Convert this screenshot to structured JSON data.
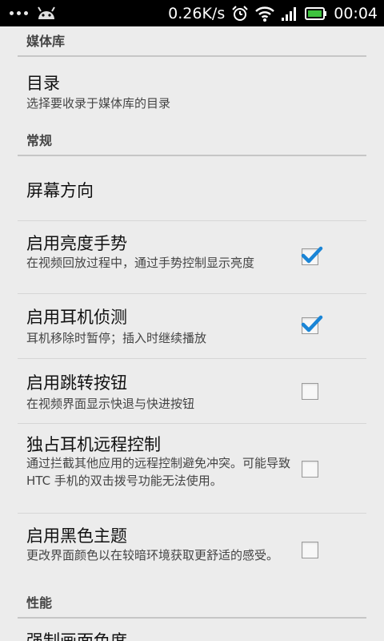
{
  "status_bar": {
    "net_speed": "0.26K/s",
    "time": "00:04",
    "icons": [
      "android-icon",
      "alarm-icon",
      "wifi-icon",
      "signal-icon",
      "battery-icon"
    ]
  },
  "colors": {
    "accent": "#1a85d6",
    "battery": "#3ec23e"
  },
  "sections": {
    "media": {
      "label": "媒体库"
    },
    "general": {
      "label": "常规"
    },
    "performance": {
      "label": "性能"
    }
  },
  "prefs": {
    "directory": {
      "title": "目录",
      "summary": "选择要收录于媒体库的目录"
    },
    "orientation": {
      "title": "屏幕方向"
    },
    "brightness": {
      "title": "启用亮度手势",
      "summary": "在视频回放过程中，通过手势控制显示亮度",
      "checked": true
    },
    "headset": {
      "title": "启用耳机侦测",
      "summary": "耳机移除时暂停；插入时继续播放",
      "checked": true
    },
    "jump": {
      "title": "启用跳转按钮",
      "summary": "在视频界面显示快退与快进按钮",
      "checked": false
    },
    "remote": {
      "title": "独占耳机远程控制",
      "summary": "通过拦截其他应用的远程控制避免冲突。可能导致 HTC 手机的双击拨号功能无法使用。",
      "checked": false
    },
    "dark_theme": {
      "title": "启用黑色主题",
      "summary": "更改界面颜色以在较暗环境获取更舒适的感受。",
      "checked": false
    },
    "chroma": {
      "title": "强制画面色度"
    }
  }
}
